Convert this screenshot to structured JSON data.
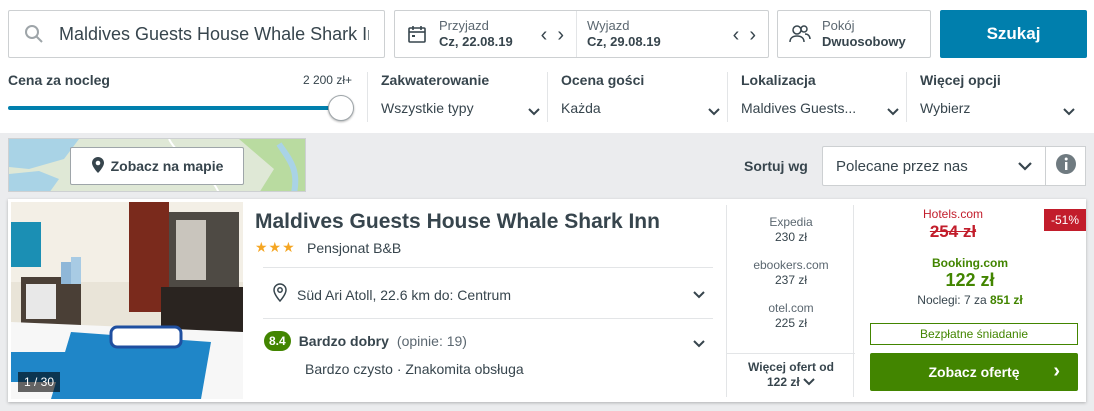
{
  "search": {
    "value": "Maldives Guests House Whale Shark Ir",
    "checkin_label": "Przyjazd",
    "checkin_value": "Cz, 22.08.19",
    "checkout_label": "Wyjazd",
    "checkout_value": "Cz, 29.08.19",
    "room_label": "Pokój",
    "room_value": "Dwuosobowy",
    "button": "Szukaj"
  },
  "filters": {
    "price_label": "Cena za nocleg",
    "price_max": "2 200 zł+",
    "price_level": 1.0,
    "items": [
      {
        "label": "Zakwaterowanie",
        "value": "Wszystkie typy"
      },
      {
        "label": "Ocena gości",
        "value": "Każda"
      },
      {
        "label": "Lokalizacja",
        "value": "Maldives Guests..."
      },
      {
        "label": "Więcej opcji",
        "value": "Wybierz"
      }
    ]
  },
  "map": {
    "button": "Zobacz na mapie"
  },
  "sort": {
    "label": "Sortuj wg",
    "value": "Polecane przez nas"
  },
  "hotel": {
    "name": "Maldives Guests House Whale Shark Inn",
    "stars": "★★★",
    "type": "Pensjonat B&B",
    "photo_counter": "1 / 30",
    "location": "Süd Ari Atoll, 22.6 km do: Centrum",
    "rating_score": "8.4",
    "rating_word": "Bardzo dobry",
    "rating_count": "(opinie: 19)",
    "tags": "Bardzo czysto · Znakomita obsługa"
  },
  "offers": [
    {
      "provider": "Expedia",
      "price": "230 zł"
    },
    {
      "provider": "ebookers.com",
      "price": "237 zł"
    },
    {
      "provider": "otel.com",
      "price": "225 zł"
    }
  ],
  "more_offers": {
    "line1": "Więcej ofert od",
    "line2": "122 zł"
  },
  "best": {
    "old_provider": "Hotels.com",
    "old_price": "254 zł",
    "discount": "-51%",
    "provider": "Booking.com",
    "price": "122 zł",
    "nights_prefix": "Noclegi: 7 za",
    "nights_total": "851 zł",
    "perk": "Bezpłatne śniadanie",
    "cta": "Zobacz ofertę"
  },
  "colors": {
    "primary": "#007fad",
    "success": "#428500",
    "danger": "#c21d2b",
    "star": "#f5a623"
  }
}
